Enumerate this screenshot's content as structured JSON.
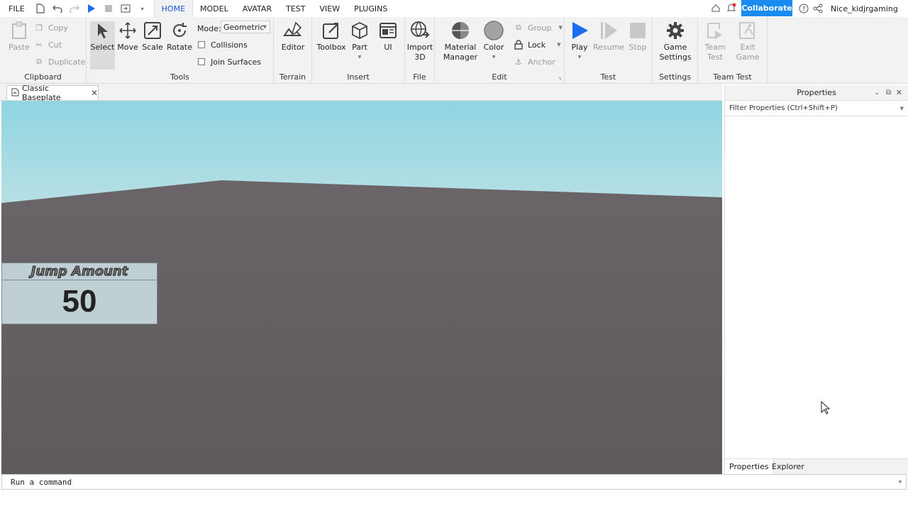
{
  "menubar": {
    "tabs": [
      {
        "label": "FILE"
      },
      {
        "label": "HOME"
      },
      {
        "label": "MODEL"
      },
      {
        "label": "AVATAR"
      },
      {
        "label": "TEST"
      },
      {
        "label": "VIEW"
      },
      {
        "label": "PLUGINS"
      }
    ],
    "active_tab": "HOME",
    "collaborate_label": "Collaborate",
    "username": "Nice_kidjrgaming",
    "collaborate_color": "#1a8cf0"
  },
  "ribbon": {
    "clipboard": {
      "paste": "Paste",
      "copy": "Copy",
      "cut": "Cut",
      "duplicate": "Duplicate",
      "label": "Clipboard"
    },
    "tools": {
      "select": "Select",
      "move": "Move",
      "scale": "Scale",
      "rotate": "Rotate",
      "mode_label": "Mode:",
      "mode_value": "Geometric",
      "collisions": "Collisions",
      "join_surfaces": "Join Surfaces",
      "label": "Tools"
    },
    "terrain": {
      "editor": "Editor",
      "label": "Terrain"
    },
    "insert": {
      "toolbox": "Toolbox",
      "part": "Part",
      "ui": "UI",
      "label": "Insert"
    },
    "file": {
      "import_line1": "Import",
      "import_line2": "3D",
      "label": "File"
    },
    "edit": {
      "material_line1": "Material",
      "material_line2": "Manager",
      "color": "Color",
      "group": "Group",
      "lock": "Lock",
      "anchor": "Anchor",
      "label": "Edit"
    },
    "test": {
      "play": "Play",
      "resume": "Resume",
      "stop": "Stop",
      "label": "Test",
      "play_color": "#1a6cf0"
    },
    "settings": {
      "game_line1": "Game",
      "game_line2": "Settings",
      "label": "Settings"
    },
    "team_test": {
      "team_line1": "Team",
      "team_line2": "Test",
      "exit_line1": "Exit",
      "exit_line2": "Game",
      "label": "Team Test"
    }
  },
  "document_tab": {
    "title": "Classic Baseplate"
  },
  "viewport": {
    "jump_gui": {
      "title": "Jump Amount",
      "value": "50"
    }
  },
  "properties_panel": {
    "title": "Properties",
    "filter_placeholder": "Filter Properties (Ctrl+Shift+P)",
    "tabs": [
      {
        "label": "Properties"
      },
      {
        "label": "Explorer"
      }
    ]
  },
  "command_bar": {
    "placeholder": "Run a command"
  }
}
